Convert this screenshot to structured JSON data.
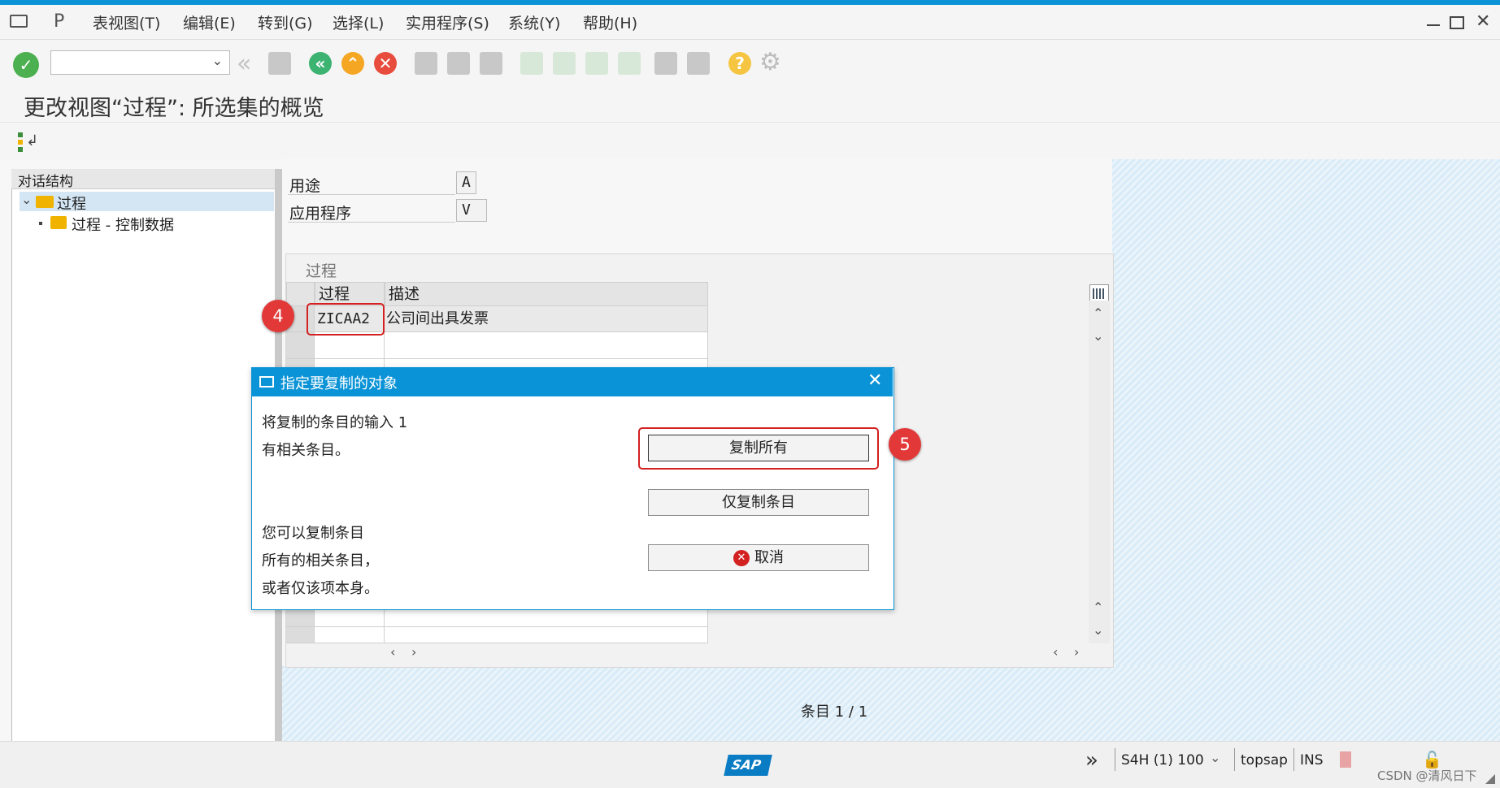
{
  "menu": {
    "items": [
      "表视图(T)",
      "编辑(E)",
      "转到(G)",
      "选择(L)",
      "实用程序(S)",
      "系统(Y)",
      "帮助(H)"
    ]
  },
  "toolbar": {
    "command_value": "",
    "icons": [
      "enter-icon",
      "back-icon",
      "exit-icon",
      "cancel-icon",
      "print-icon",
      "find-icon",
      "find-next-icon",
      "first-page-icon",
      "prev-page-icon",
      "next-page-icon",
      "last-page-icon",
      "create-session-icon",
      "shortcut-icon",
      "help-icon",
      "settings-icon"
    ]
  },
  "page": {
    "title": "更改视图“过程”: 所选集的概览"
  },
  "tree": {
    "header": "对话结构",
    "items": [
      "过程",
      "过程 - 控制数据"
    ]
  },
  "fields": {
    "usage_label": "用途",
    "usage_value": "A",
    "app_label": "应用程序",
    "app_value": "V"
  },
  "table": {
    "title": "过程",
    "columns": [
      "过程",
      "描述"
    ],
    "rows": [
      {
        "process": "ZICAA2",
        "description": "公司间出具发票"
      }
    ],
    "entry_label": "条目",
    "entry_count": "1 / 1"
  },
  "dialog": {
    "title": "指定要复制的对象",
    "line1": "将复制的条目的输入 1",
    "line2": "有相关条目。",
    "line3": "您可以复制条目",
    "line4": "所有的相关条目，",
    "line5": "或者仅该项本身。",
    "copy_all": "复制所有",
    "copy_entry_only": "仅复制条目",
    "cancel": "取消"
  },
  "callouts": {
    "step4": "4",
    "step5": "5"
  },
  "status": {
    "system": "S4H (1) 100",
    "server": "topsap",
    "mode": "INS",
    "logo": "SAP",
    "watermark": "CSDN @清风日下"
  },
  "colors": {
    "accent": "#0a93d6",
    "callout": "#e23838",
    "enter_green": "#4caf50",
    "back_green": "#3cb371",
    "exit_orange": "#f5a623",
    "cancel_red": "#e74c3c",
    "help_yellow": "#f5c542",
    "folder": "#f0b400"
  }
}
